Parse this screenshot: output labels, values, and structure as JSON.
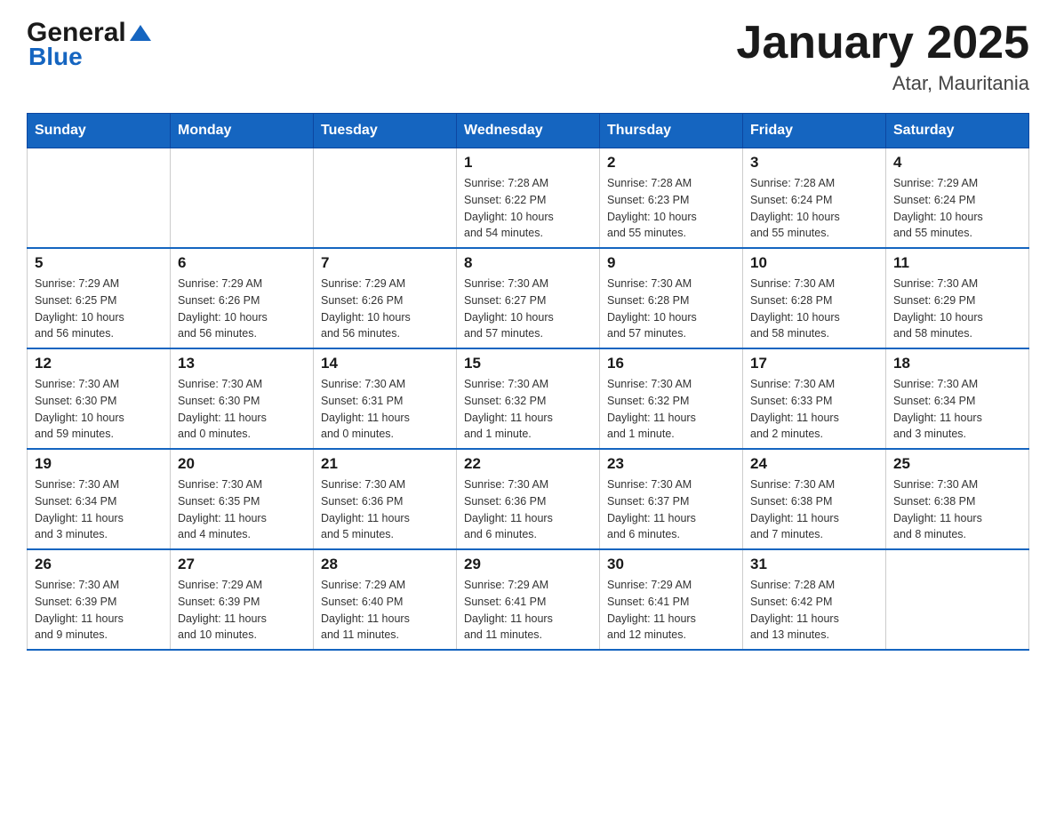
{
  "header": {
    "logo_general": "General",
    "logo_blue": "Blue",
    "title": "January 2025",
    "subtitle": "Atar, Mauritania"
  },
  "days_of_week": [
    "Sunday",
    "Monday",
    "Tuesday",
    "Wednesday",
    "Thursday",
    "Friday",
    "Saturday"
  ],
  "weeks": [
    [
      {
        "day": "",
        "info": ""
      },
      {
        "day": "",
        "info": ""
      },
      {
        "day": "",
        "info": ""
      },
      {
        "day": "1",
        "info": "Sunrise: 7:28 AM\nSunset: 6:22 PM\nDaylight: 10 hours\nand 54 minutes."
      },
      {
        "day": "2",
        "info": "Sunrise: 7:28 AM\nSunset: 6:23 PM\nDaylight: 10 hours\nand 55 minutes."
      },
      {
        "day": "3",
        "info": "Sunrise: 7:28 AM\nSunset: 6:24 PM\nDaylight: 10 hours\nand 55 minutes."
      },
      {
        "day": "4",
        "info": "Sunrise: 7:29 AM\nSunset: 6:24 PM\nDaylight: 10 hours\nand 55 minutes."
      }
    ],
    [
      {
        "day": "5",
        "info": "Sunrise: 7:29 AM\nSunset: 6:25 PM\nDaylight: 10 hours\nand 56 minutes."
      },
      {
        "day": "6",
        "info": "Sunrise: 7:29 AM\nSunset: 6:26 PM\nDaylight: 10 hours\nand 56 minutes."
      },
      {
        "day": "7",
        "info": "Sunrise: 7:29 AM\nSunset: 6:26 PM\nDaylight: 10 hours\nand 56 minutes."
      },
      {
        "day": "8",
        "info": "Sunrise: 7:30 AM\nSunset: 6:27 PM\nDaylight: 10 hours\nand 57 minutes."
      },
      {
        "day": "9",
        "info": "Sunrise: 7:30 AM\nSunset: 6:28 PM\nDaylight: 10 hours\nand 57 minutes."
      },
      {
        "day": "10",
        "info": "Sunrise: 7:30 AM\nSunset: 6:28 PM\nDaylight: 10 hours\nand 58 minutes."
      },
      {
        "day": "11",
        "info": "Sunrise: 7:30 AM\nSunset: 6:29 PM\nDaylight: 10 hours\nand 58 minutes."
      }
    ],
    [
      {
        "day": "12",
        "info": "Sunrise: 7:30 AM\nSunset: 6:30 PM\nDaylight: 10 hours\nand 59 minutes."
      },
      {
        "day": "13",
        "info": "Sunrise: 7:30 AM\nSunset: 6:30 PM\nDaylight: 11 hours\nand 0 minutes."
      },
      {
        "day": "14",
        "info": "Sunrise: 7:30 AM\nSunset: 6:31 PM\nDaylight: 11 hours\nand 0 minutes."
      },
      {
        "day": "15",
        "info": "Sunrise: 7:30 AM\nSunset: 6:32 PM\nDaylight: 11 hours\nand 1 minute."
      },
      {
        "day": "16",
        "info": "Sunrise: 7:30 AM\nSunset: 6:32 PM\nDaylight: 11 hours\nand 1 minute."
      },
      {
        "day": "17",
        "info": "Sunrise: 7:30 AM\nSunset: 6:33 PM\nDaylight: 11 hours\nand 2 minutes."
      },
      {
        "day": "18",
        "info": "Sunrise: 7:30 AM\nSunset: 6:34 PM\nDaylight: 11 hours\nand 3 minutes."
      }
    ],
    [
      {
        "day": "19",
        "info": "Sunrise: 7:30 AM\nSunset: 6:34 PM\nDaylight: 11 hours\nand 3 minutes."
      },
      {
        "day": "20",
        "info": "Sunrise: 7:30 AM\nSunset: 6:35 PM\nDaylight: 11 hours\nand 4 minutes."
      },
      {
        "day": "21",
        "info": "Sunrise: 7:30 AM\nSunset: 6:36 PM\nDaylight: 11 hours\nand 5 minutes."
      },
      {
        "day": "22",
        "info": "Sunrise: 7:30 AM\nSunset: 6:36 PM\nDaylight: 11 hours\nand 6 minutes."
      },
      {
        "day": "23",
        "info": "Sunrise: 7:30 AM\nSunset: 6:37 PM\nDaylight: 11 hours\nand 6 minutes."
      },
      {
        "day": "24",
        "info": "Sunrise: 7:30 AM\nSunset: 6:38 PM\nDaylight: 11 hours\nand 7 minutes."
      },
      {
        "day": "25",
        "info": "Sunrise: 7:30 AM\nSunset: 6:38 PM\nDaylight: 11 hours\nand 8 minutes."
      }
    ],
    [
      {
        "day": "26",
        "info": "Sunrise: 7:30 AM\nSunset: 6:39 PM\nDaylight: 11 hours\nand 9 minutes."
      },
      {
        "day": "27",
        "info": "Sunrise: 7:29 AM\nSunset: 6:39 PM\nDaylight: 11 hours\nand 10 minutes."
      },
      {
        "day": "28",
        "info": "Sunrise: 7:29 AM\nSunset: 6:40 PM\nDaylight: 11 hours\nand 11 minutes."
      },
      {
        "day": "29",
        "info": "Sunrise: 7:29 AM\nSunset: 6:41 PM\nDaylight: 11 hours\nand 11 minutes."
      },
      {
        "day": "30",
        "info": "Sunrise: 7:29 AM\nSunset: 6:41 PM\nDaylight: 11 hours\nand 12 minutes."
      },
      {
        "day": "31",
        "info": "Sunrise: 7:28 AM\nSunset: 6:42 PM\nDaylight: 11 hours\nand 13 minutes."
      },
      {
        "day": "",
        "info": ""
      }
    ]
  ]
}
